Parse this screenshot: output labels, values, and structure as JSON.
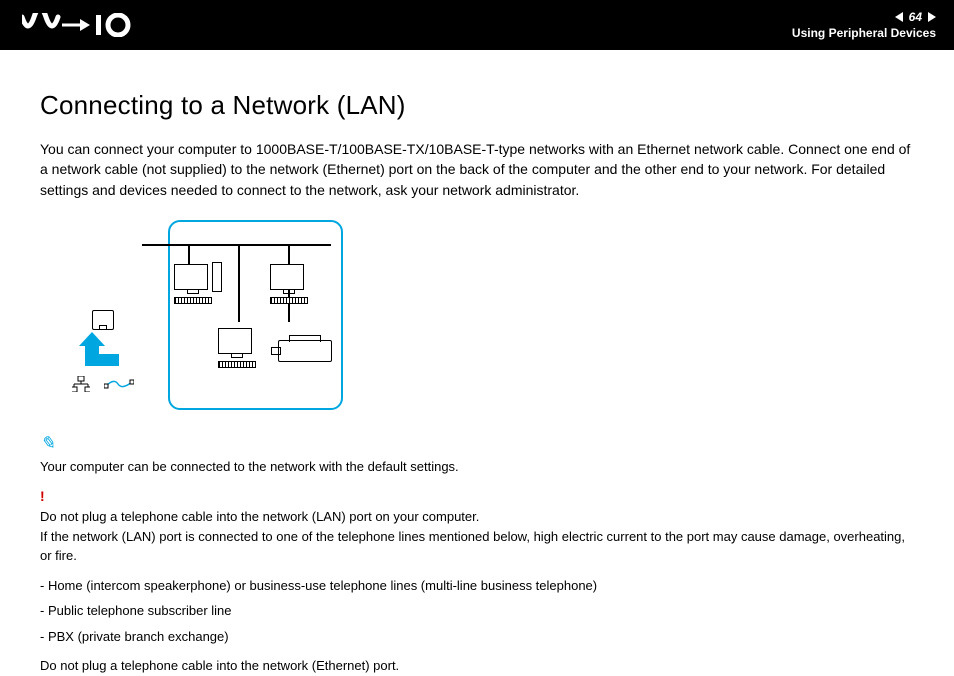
{
  "header": {
    "page_number": "64",
    "section_title": "Using Peripheral Devices"
  },
  "title": "Connecting to a Network (LAN)",
  "intro": "You can connect your computer to 1000BASE-T/100BASE-TX/10BASE-T-type networks with an Ethernet network cable. Connect one end of a network cable (not supplied) to the network (Ethernet) port on the back of the computer and the other end to your network. For detailed settings and devices needed to connect to the network, ask your network administrator.",
  "note_default": "Your computer can be connected to the network with the default settings.",
  "warning": {
    "line1": "Do not plug a telephone cable into the network (LAN) port on your computer.",
    "line2": "If the network (LAN) port is connected to one of the telephone lines mentioned below, high electric current to the port may cause damage, overheating, or fire.",
    "bullets": [
      "- Home (intercom speakerphone) or business-use telephone lines (multi-line business telephone)",
      "- Public telephone subscriber line",
      "- PBX (private branch exchange)"
    ]
  },
  "final_note": "Do not plug a telephone cable into the network (Ethernet) port."
}
